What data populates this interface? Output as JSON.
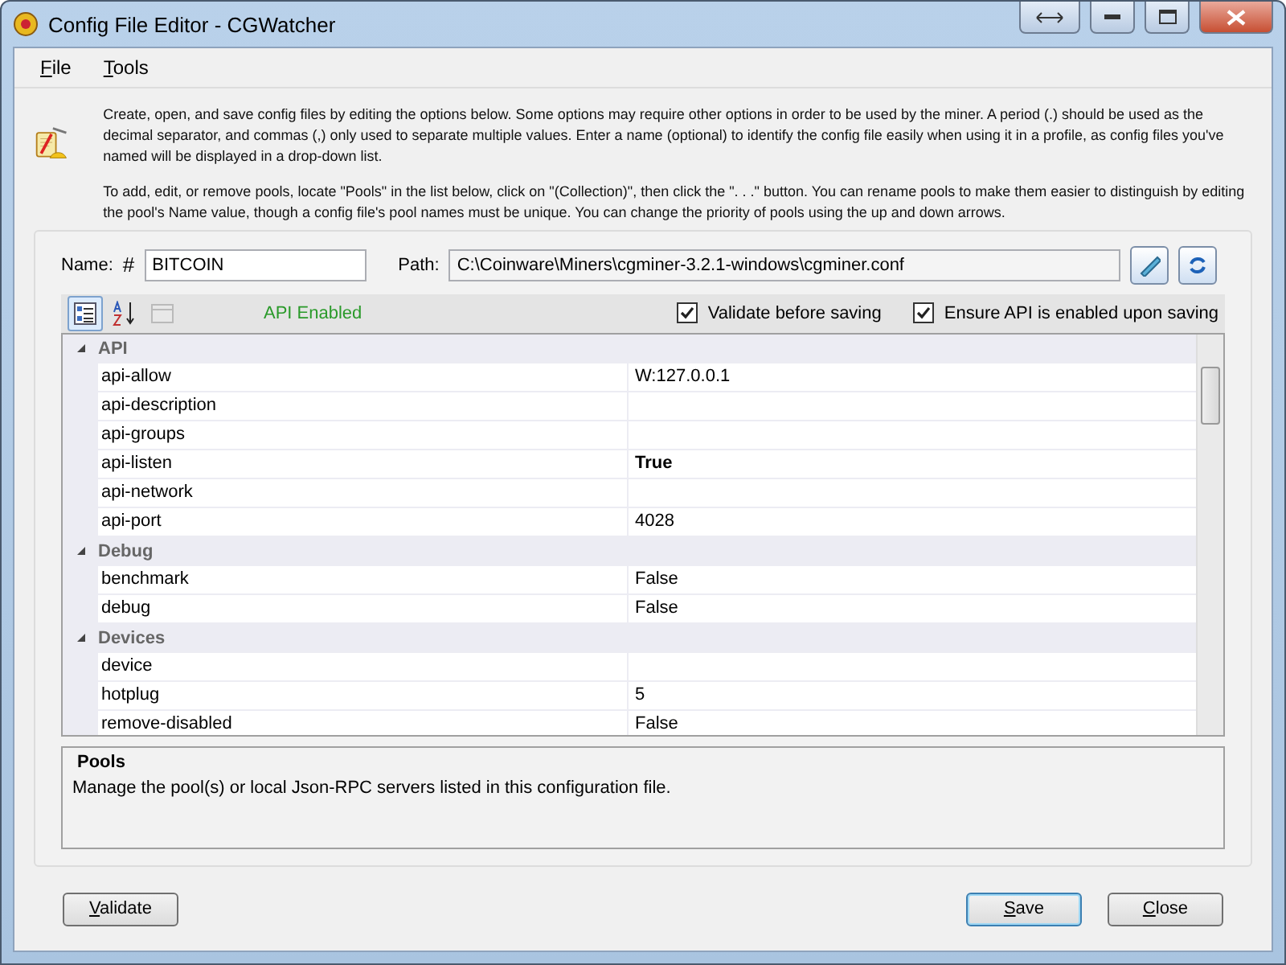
{
  "window": {
    "title": "Config File Editor - CGWatcher"
  },
  "menu": [
    {
      "label": "File"
    },
    {
      "label": "Tools"
    }
  ],
  "info": {
    "paragraphs": [
      "Create, open, and save config files by editing the options below. Some options may require other options in order to be used by the miner. A period (.) should be used as the decimal separator, and commas (,) only used to separate multiple values. Enter a name (optional) to identify the config file easily when using it in a profile, as config files you've named will be displayed in a drop-down list.",
      "To add, edit, or remove pools, locate \"Pools\" in the list below, click on \"(Collection)\", then click the \". . .\" button. You can rename pools to make them easier to distinguish by editing the pool's Name value, though a config file's pool names must be unique. You can change the priority of pools using the up and down arrows."
    ]
  },
  "name_field": {
    "label": "Name:",
    "prefix": "#",
    "value": "BITCOIN"
  },
  "path_field": {
    "label": "Path:",
    "value": "C:\\Coinware\\Miners\\cgminer-3.2.1-windows\\cgminer.conf"
  },
  "toolbar": {
    "buttons": [
      {
        "kind": "categorized",
        "selected": true,
        "disabled": false
      },
      {
        "kind": "alphabetical",
        "selected": false,
        "disabled": false
      },
      {
        "kind": "pages",
        "selected": false,
        "disabled": true
      }
    ],
    "status": "API Enabled",
    "checkboxes": [
      {
        "label": "Validate before saving",
        "checked": true
      },
      {
        "label": "Ensure API is enabled upon saving",
        "checked": true
      }
    ]
  },
  "grid": {
    "categories": [
      {
        "name": "API",
        "expanded": true,
        "items": [
          {
            "name": "api-allow",
            "value": "W:127.0.0.1",
            "modified": false
          },
          {
            "name": "api-description",
            "modified": false
          },
          {
            "name": "api-groups",
            "modified": false
          },
          {
            "name": "api-listen",
            "value": "True",
            "modified": true
          },
          {
            "name": "api-network",
            "modified": false
          },
          {
            "name": "api-port",
            "value": "4028",
            "modified": false
          }
        ]
      },
      {
        "name": "Debug",
        "expanded": true,
        "items": [
          {
            "name": "benchmark",
            "value": "False",
            "modified": false
          },
          {
            "name": "debug",
            "value": "False",
            "modified": false
          }
        ]
      },
      {
        "name": "Devices",
        "expanded": true,
        "items": [
          {
            "name": "device",
            "modified": false
          },
          {
            "name": "hotplug",
            "value": "5",
            "modified": false
          },
          {
            "name": "remove-disabled",
            "value": "False",
            "modified": false
          }
        ]
      }
    ]
  },
  "description": {
    "title": "Pools",
    "text": "Manage the pool(s) or local Json-RPC servers listed in this configuration file."
  },
  "buttons": [
    {
      "label": "Validate",
      "default": false
    },
    {
      "label": "Save",
      "default": true
    },
    {
      "label": "Close",
      "default": false
    }
  ]
}
